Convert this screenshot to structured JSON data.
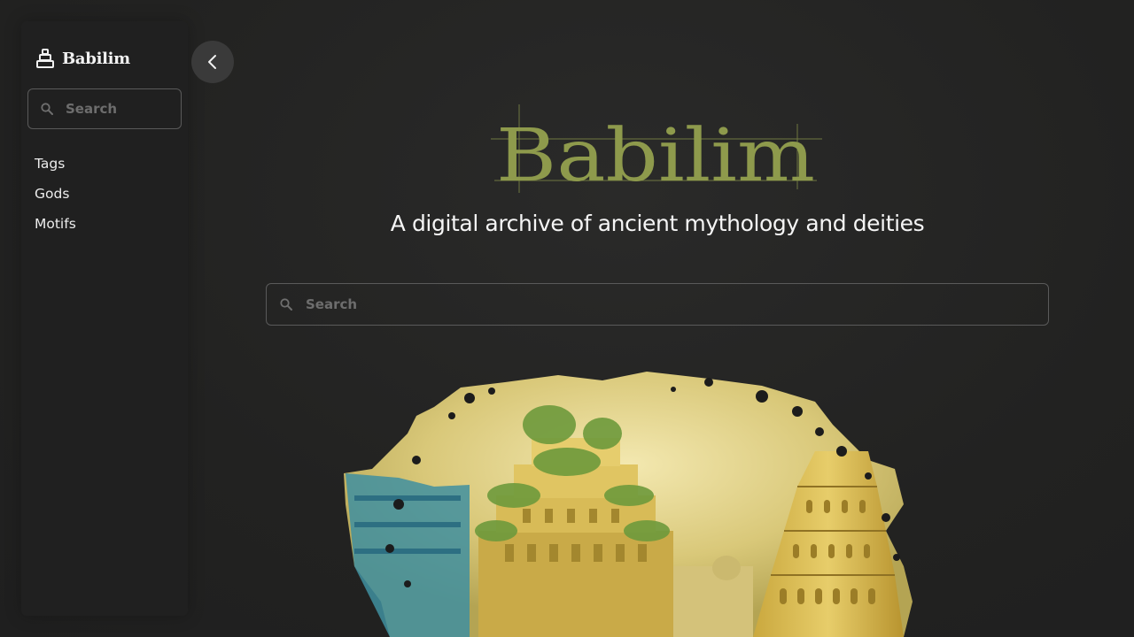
{
  "sidebar": {
    "brand": {
      "name": "Babilim",
      "icon": "ziggurat-icon"
    },
    "search": {
      "placeholder": "Search"
    },
    "items": [
      {
        "label": "Tags"
      },
      {
        "label": "Gods"
      },
      {
        "label": "Motifs"
      }
    ]
  },
  "collapse_button": {
    "icon": "chevron-left-icon"
  },
  "hero": {
    "logo_text": "Babilim",
    "subtitle": "A digital archive of ancient mythology and deities",
    "search": {
      "placeholder": "Search"
    },
    "image": "babylon-gardens-and-tower-illustration"
  },
  "colors": {
    "background": "#232323",
    "sidebar": "#202020",
    "logo_olive": "#8e9a4c",
    "text": "#ececec",
    "border": "#5a5a5a"
  }
}
